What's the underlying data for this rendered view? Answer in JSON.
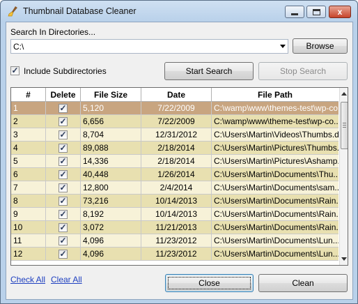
{
  "window": {
    "title": "Thumbnail Database Cleaner",
    "close_glyph": "x",
    "accent_color": "#b9d1ea"
  },
  "search": {
    "label": "Search In Directories...",
    "directory_value": "C:\\",
    "browse_label": "Browse"
  },
  "options": {
    "include_subdirs_label": "Include Subdirectories",
    "include_subdirs_checked": true,
    "start_label": "Start Search",
    "stop_label": "Stop Search"
  },
  "table": {
    "columns": [
      "#",
      "Delete",
      "File Size",
      "Date",
      "File Path"
    ],
    "check_glyph": "✓",
    "rows": [
      {
        "num": "1",
        "size": "5,120",
        "date": "7/22/2009",
        "path": "C:\\wamp\\www\\themes-test\\wp-co..."
      },
      {
        "num": "2",
        "size": "6,656",
        "date": "7/22/2009",
        "path": "C:\\wamp\\www\\theme-test\\wp-co..."
      },
      {
        "num": "3",
        "size": "8,704",
        "date": "12/31/2012",
        "path": "C:\\Users\\Martin\\Videos\\Thumbs.db"
      },
      {
        "num": "4",
        "size": "89,088",
        "date": "2/18/2014",
        "path": "C:\\Users\\Martin\\Pictures\\Thumbs..."
      },
      {
        "num": "5",
        "size": "14,336",
        "date": "2/18/2014",
        "path": "C:\\Users\\Martin\\Pictures\\Ashamp..."
      },
      {
        "num": "6",
        "size": "40,448",
        "date": "1/26/2014",
        "path": "C:\\Users\\Martin\\Documents\\Thu..."
      },
      {
        "num": "7",
        "size": "12,800",
        "date": "2/4/2014",
        "path": "C:\\Users\\Martin\\Documents\\sam..."
      },
      {
        "num": "8",
        "size": "73,216",
        "date": "10/14/2013",
        "path": "C:\\Users\\Martin\\Documents\\Rain..."
      },
      {
        "num": "9",
        "size": "8,192",
        "date": "10/14/2013",
        "path": "C:\\Users\\Martin\\Documents\\Rain..."
      },
      {
        "num": "10",
        "size": "3,072",
        "date": "11/21/2013",
        "path": "C:\\Users\\Martin\\Documents\\Rain..."
      },
      {
        "num": "11",
        "size": "4,096",
        "date": "11/23/2012",
        "path": "C:\\Users\\Martin\\Documents\\Lun..."
      },
      {
        "num": "12",
        "size": "4,096",
        "date": "11/23/2012",
        "path": "C:\\Users\\Martin\\Documents\\Lun..."
      }
    ],
    "selected_row_index": 0,
    "selected_color": "#c8a580",
    "stripe_colors": [
      "#f7f2d8",
      "#e8e0b0"
    ]
  },
  "footer": {
    "check_all": "Check All",
    "clear_all": "Clear All",
    "close_label": "Close",
    "clean_label": "Clean"
  }
}
